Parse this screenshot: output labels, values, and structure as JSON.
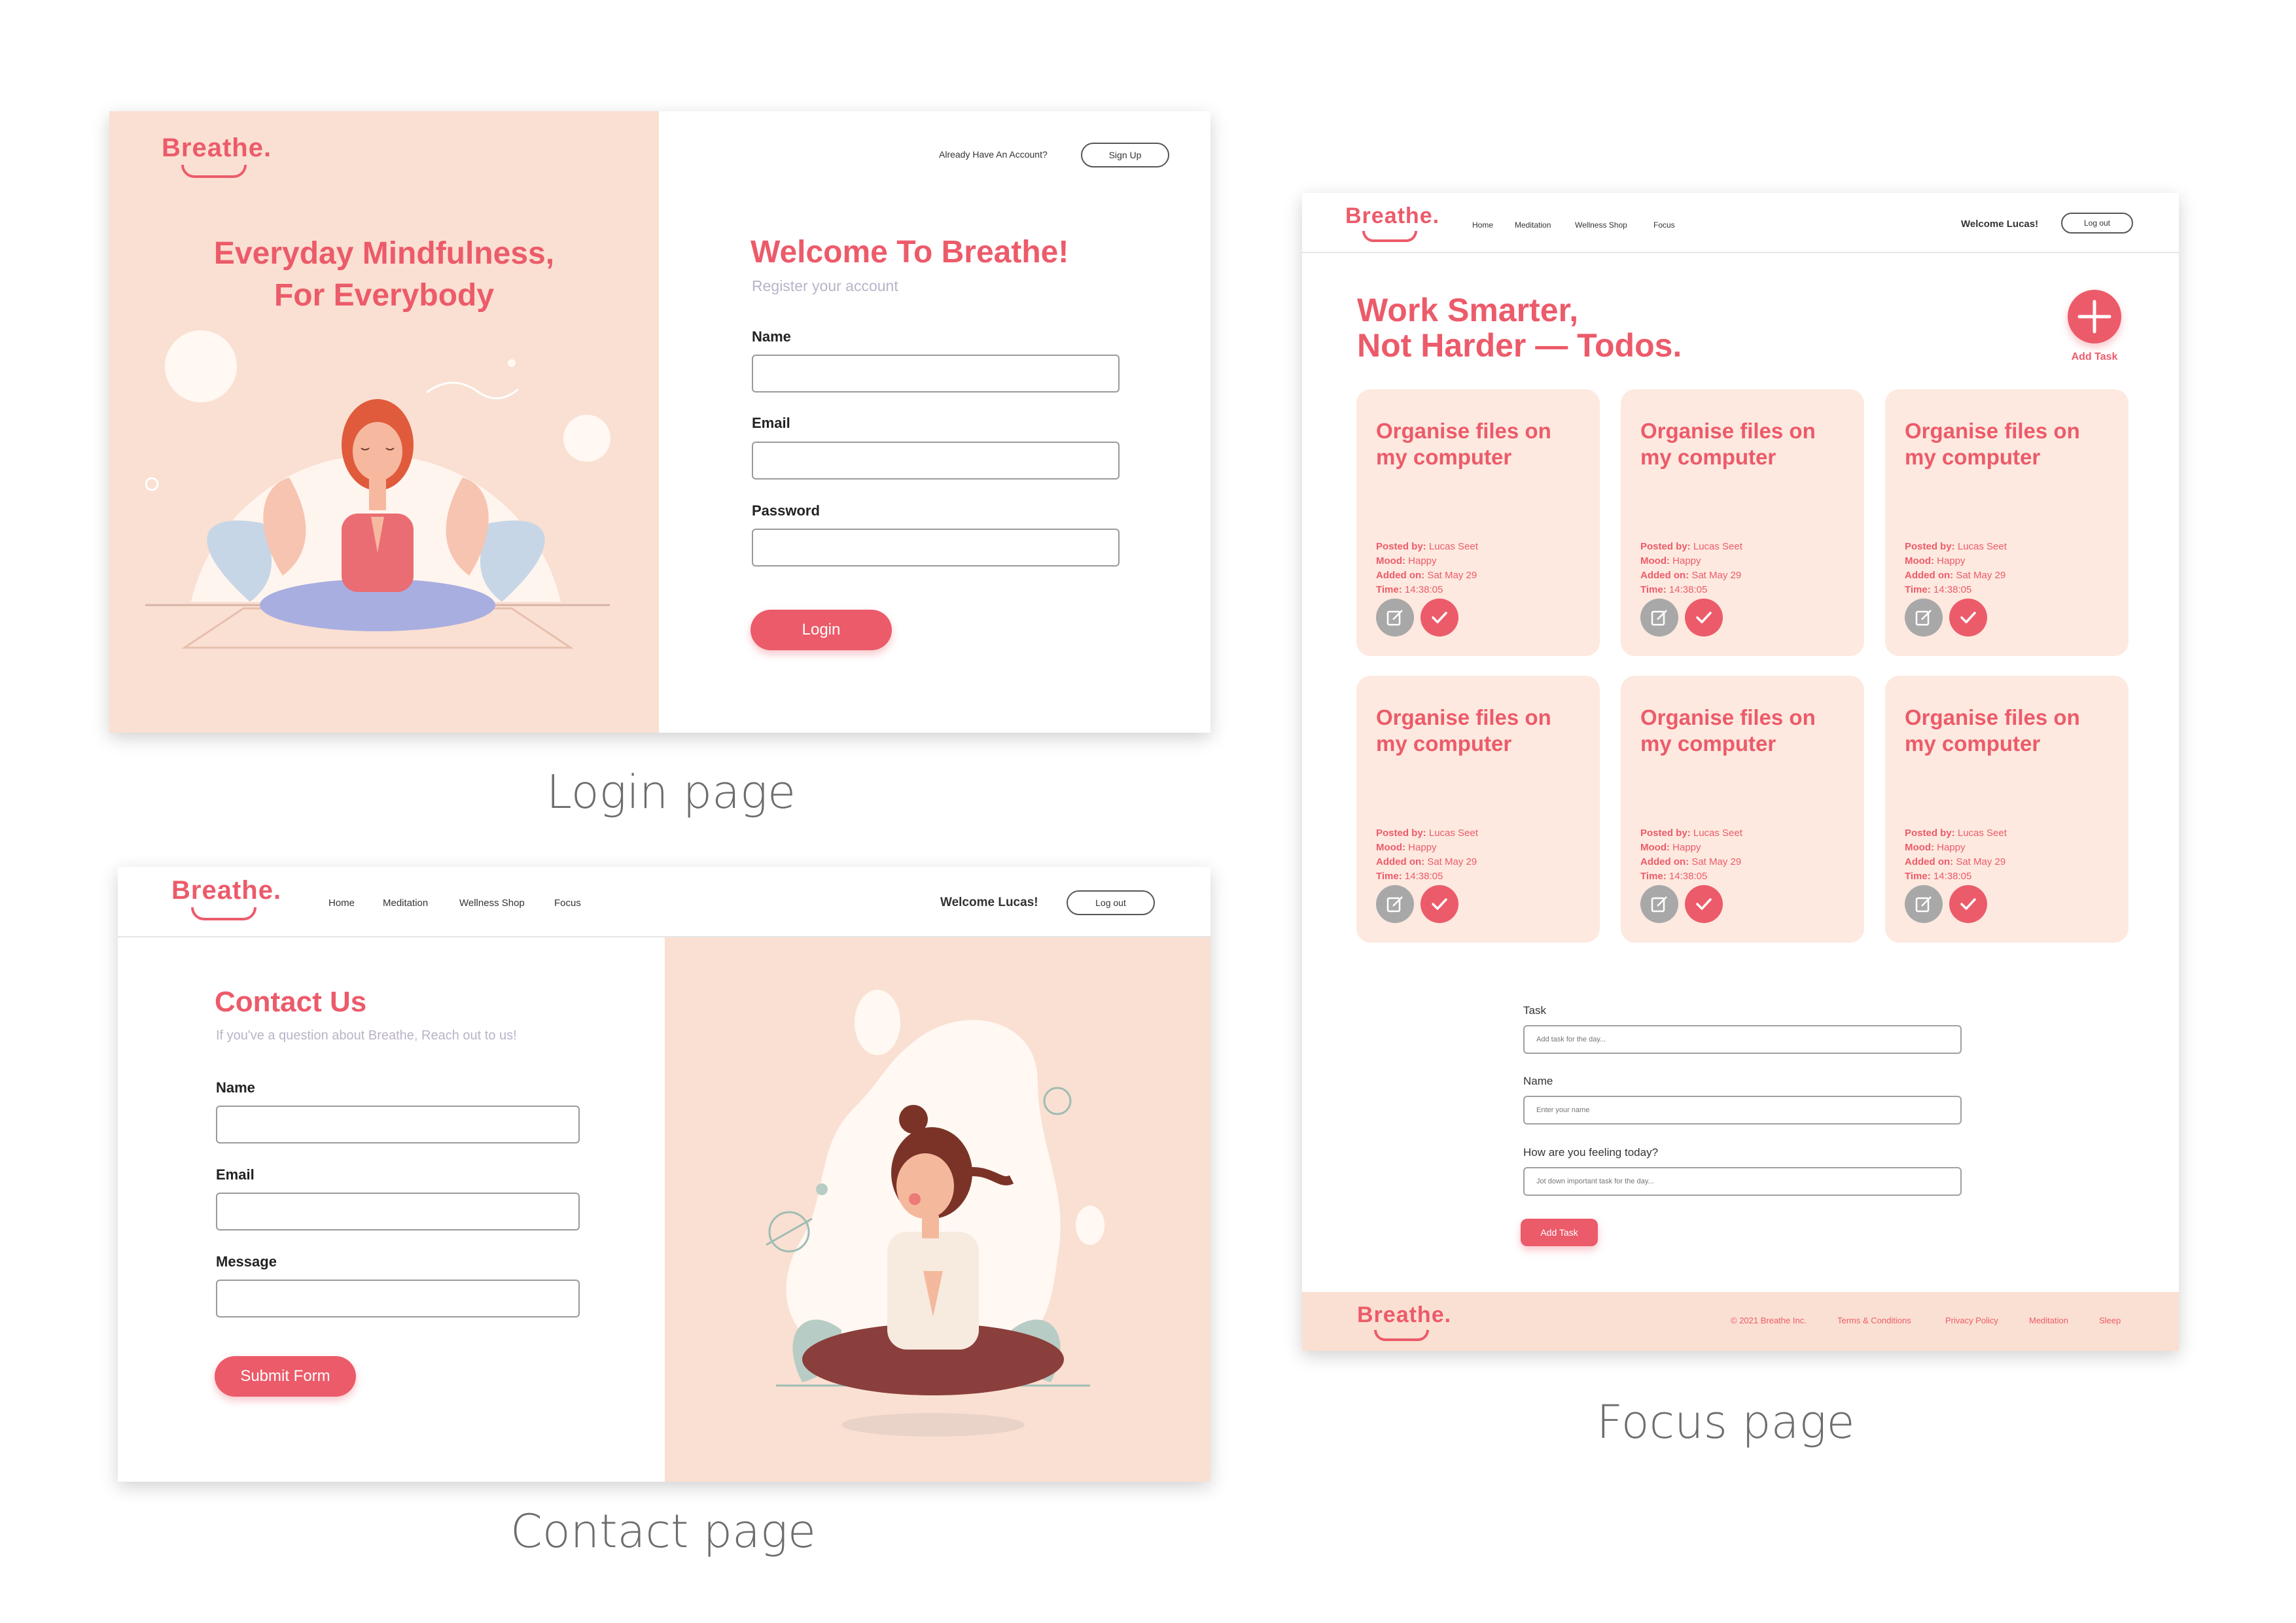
{
  "login": {
    "brand": "Breathe.",
    "already_text": "Already Have An Account?",
    "signup_label": "Sign Up",
    "hero_line1": "Everyday Mindfulness,",
    "hero_line2": "For Everybody",
    "welcome": "Welcome To Breathe!",
    "subtitle": "Register your account",
    "name_label": "Name",
    "email_label": "Email",
    "password_label": "Password",
    "login_button": "Login"
  },
  "contact": {
    "brand": "Breathe.",
    "nav": [
      "Home",
      "Meditation",
      "Wellness Shop",
      "Focus"
    ],
    "welcome_user": "Welcome Lucas!",
    "logout_label": "Log out",
    "title": "Contact Us",
    "subtitle": "If you've a question about Breathe, Reach out to us!",
    "name_label": "Name",
    "email_label": "Email",
    "message_label": "Message",
    "submit_label": "Submit Form"
  },
  "focus": {
    "brand": "Breathe.",
    "nav": [
      "Home",
      "Meditation",
      "Wellness Shop",
      "Focus"
    ],
    "welcome_user": "Welcome Lucas!",
    "logout_label": "Log out",
    "title_line1": "Work Smarter,",
    "title_line2": "Not Harder — Todos.",
    "add_task_label": "Add Task",
    "cards": [
      {
        "title": "Organise files on my computer",
        "posted_by_label": "Posted by:",
        "posted_by": "Lucas Seet",
        "mood_label": "Mood:",
        "mood": "Happy",
        "added_label": "Added on:",
        "added": "Sat May 29",
        "time_label": "Time:",
        "time": "14:38:05"
      },
      {
        "title": "Organise files on my computer",
        "posted_by_label": "Posted by:",
        "posted_by": "Lucas Seet",
        "mood_label": "Mood:",
        "mood": "Happy",
        "added_label": "Added on:",
        "added": "Sat May 29",
        "time_label": "Time:",
        "time": "14:38:05"
      },
      {
        "title": "Organise files on my computer",
        "posted_by_label": "Posted by:",
        "posted_by": "Lucas Seet",
        "mood_label": "Mood:",
        "mood": "Happy",
        "added_label": "Added on:",
        "added": "Sat May 29",
        "time_label": "Time:",
        "time": "14:38:05"
      },
      {
        "title": "Organise files on my computer",
        "posted_by_label": "Posted by:",
        "posted_by": "Lucas Seet",
        "mood_label": "Mood:",
        "mood": "Happy",
        "added_label": "Added on:",
        "added": "Sat May 29",
        "time_label": "Time:",
        "time": "14:38:05"
      },
      {
        "title": "Organise files on my computer",
        "posted_by_label": "Posted by:",
        "posted_by": "Lucas Seet",
        "mood_label": "Mood:",
        "mood": "Happy",
        "added_label": "Added on:",
        "added": "Sat May 29",
        "time_label": "Time:",
        "time": "14:38:05"
      },
      {
        "title": "Organise files on my computer",
        "posted_by_label": "Posted by:",
        "posted_by": "Lucas Seet",
        "mood_label": "Mood:",
        "mood": "Happy",
        "added_label": "Added on:",
        "added": "Sat May 29",
        "time_label": "Time:",
        "time": "14:38:05"
      }
    ],
    "form": {
      "task_label": "Task",
      "task_placeholder": "Add task for the day...",
      "name_label": "Name",
      "name_placeholder": "Enter your name",
      "feeling_label": "How are you feeling today?",
      "feeling_placeholder": "Jot down important task for the day...",
      "submit_label": "Add Task"
    },
    "footer": {
      "brand": "Breathe.",
      "links": [
        "© 2021 Breathe Inc.",
        "Terms & Conditions",
        "Privacy Policy",
        "Meditation",
        "Sleep"
      ]
    }
  },
  "captions": {
    "login": "Login page",
    "contact": "Contact page",
    "focus": "Focus page"
  },
  "colors": {
    "accent": "#ec5b6a",
    "peach": "#fae0d2",
    "card": "#fde9df"
  }
}
